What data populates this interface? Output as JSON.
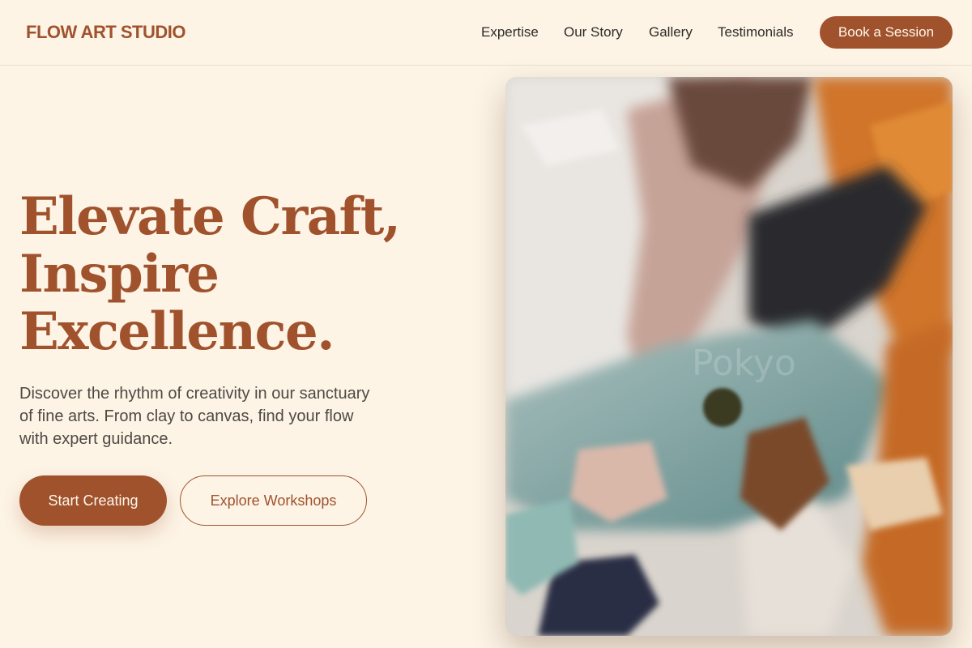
{
  "header": {
    "logo": "FLOW ART STUDIO",
    "nav": [
      "Expertise",
      "Our Story",
      "Gallery",
      "Testimonials"
    ],
    "cta": "Book a Session"
  },
  "hero": {
    "headline": [
      "Elevate Craft,",
      "Inspire",
      "Excellence."
    ],
    "subtext": "Discover the rhythm of creativity in our sanctuary of fine arts. From clay to canvas, find your flow with expert guidance.",
    "primary_button": "Start Creating",
    "secondary_button": "Explore Workshops",
    "image": {
      "watermark": "Pokyo"
    }
  },
  "colors": {
    "background": "#fdf4e6",
    "accent": "#a0522d",
    "text": "#2e2a26",
    "muted_text": "#4e4942"
  }
}
